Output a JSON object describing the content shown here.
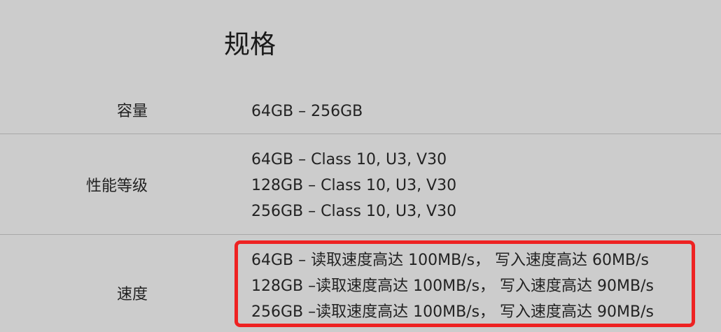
{
  "page_title": "规格",
  "specs": [
    {
      "label": "容量",
      "values": [
        "64GB – 256GB"
      ]
    },
    {
      "label": "性能等级",
      "values": [
        "64GB – Class 10, U3, V30",
        "128GB – Class 10, U3, V30",
        "256GB – Class 10, U3, V30"
      ]
    },
    {
      "label": "速度",
      "values": [
        "64GB – 读取速度高达 100MB/s， 写入速度高达 60MB/s",
        "128GB –读取速度高达 100MB/s， 写入速度高达 90MB/s",
        "256GB –读取速度高达 100MB/s， 写入速度高达 90MB/s"
      ],
      "highlighted": true
    }
  ],
  "colors": {
    "background": "#cccccc",
    "text": "#222222",
    "divider": "#a8a8a8",
    "highlight_border": "#ee2222"
  }
}
